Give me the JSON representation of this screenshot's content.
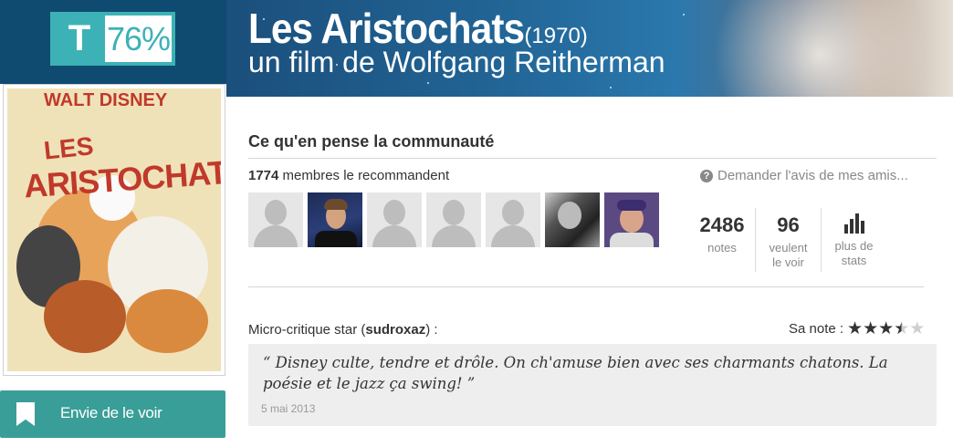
{
  "header": {
    "title": "Les Aristochats",
    "year": "(1970)",
    "subtitle": "un film de Wolfgang Reitherman"
  },
  "score": {
    "badge_letter": "T",
    "percent": "76%",
    "accent_color": "#3cb2b6"
  },
  "poster": {
    "line1": "WALT DISNEY",
    "line2": "LES",
    "line3": "ARISTOCHATS"
  },
  "wishlist_button": {
    "label": "Envie de le voir",
    "icon": "bookmark-icon",
    "color": "#3a9e98"
  },
  "community": {
    "title": "Ce qu'en pense la communauté",
    "recommend_count": "1774",
    "recommend_text": " membres le recommandent",
    "ask_friends": "Demander l'avis de mes amis...",
    "ask_icon": "question-icon",
    "avatars": [
      "default",
      "photo1",
      "default",
      "default",
      "default",
      "photo2",
      "photo3"
    ],
    "stats": [
      {
        "num": "2486",
        "label": "notes"
      },
      {
        "num": "96",
        "label": "veulent le voir"
      },
      {
        "num": "",
        "label": "plus de stats",
        "icon": "bar-chart-icon"
      }
    ]
  },
  "micro_critique": {
    "label_prefix": "Micro-critique star (",
    "author": "sudroxaz",
    "label_suffix": ") :",
    "note_label": "Sa note :",
    "rating_out_of_5": 3.5,
    "quote": "“ Disney culte, tendre et drôle. On ch'amuse bien avec ses charmants chatons. La poésie et le jazz ça swing!  ”",
    "date": "5 mai 2013"
  }
}
